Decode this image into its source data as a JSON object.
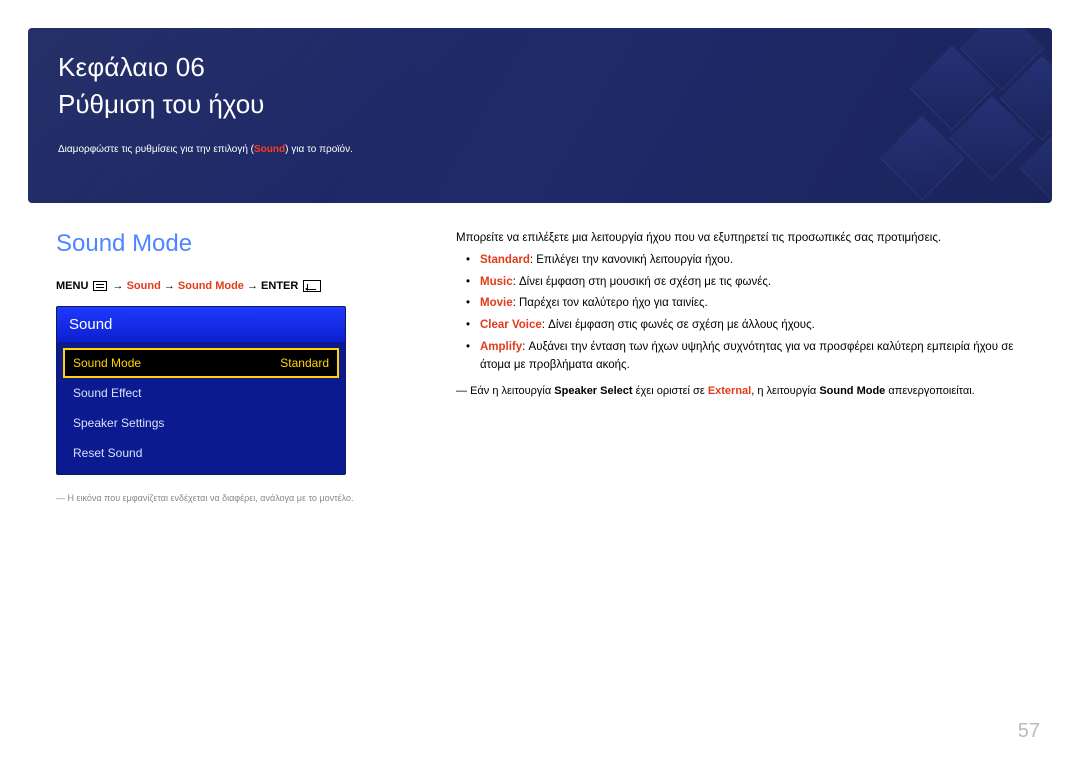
{
  "hero": {
    "chapter_label": "Κεφάλαιο 06",
    "chapter_title": "Ρύθμιση του ήχου",
    "subline_pre": "Διαμορφώστε τις ρυθμίσεις για την επιλογή (",
    "subline_accent": "Sound",
    "subline_post": ") για το προϊόν."
  },
  "section": {
    "title": "Sound Mode"
  },
  "breadcrumb": {
    "menu": "MENU",
    "p1": "Sound",
    "p2": "Sound Mode",
    "enter": "ENTER"
  },
  "osd": {
    "header": "Sound",
    "rows": [
      {
        "label": "Sound Mode",
        "value": "Standard",
        "selected": true
      },
      {
        "label": "Sound Effect",
        "value": "",
        "selected": false
      },
      {
        "label": "Speaker Settings",
        "value": "",
        "selected": false
      },
      {
        "label": "Reset Sound",
        "value": "",
        "selected": false
      }
    ]
  },
  "left_note": "Η εικόνα που εμφανίζεται ενδέχεται να διαφέρει, ανάλογα με το μοντέλο.",
  "right": {
    "intro": "Μπορείτε να επιλέξετε μια λειτουργία ήχου που να εξυπηρετεί τις προσωπικές σας προτιμήσεις.",
    "items": [
      {
        "name": "Standard",
        "desc": ": Επιλέγει την κανονική λειτουργία ήχου."
      },
      {
        "name": "Music",
        "desc": ": Δίνει έμφαση στη μουσική σε σχέση με τις φωνές."
      },
      {
        "name": "Movie",
        "desc": ": Παρέχει τον καλύτερο ήχο για ταινίες."
      },
      {
        "name": "Clear Voice",
        "desc": ": Δίνει έμφαση στις φωνές σε σχέση με άλλους ήχους."
      },
      {
        "name": "Amplify",
        "desc": ": Αυξάνει την ένταση των ήχων υψηλής συχνότητας για να προσφέρει καλύτερη εμπειρία ήχου σε άτομα με προβλήματα ακοής."
      }
    ],
    "note_pre": "Εάν η λειτουργία ",
    "note_b1": "Speaker Select",
    "note_mid1": " έχει οριστεί σε ",
    "note_accent": "External",
    "note_mid2": ", η λειτουργία ",
    "note_b2": "Sound Mode",
    "note_post": " απενεργοποιείται."
  },
  "page_number": "57"
}
